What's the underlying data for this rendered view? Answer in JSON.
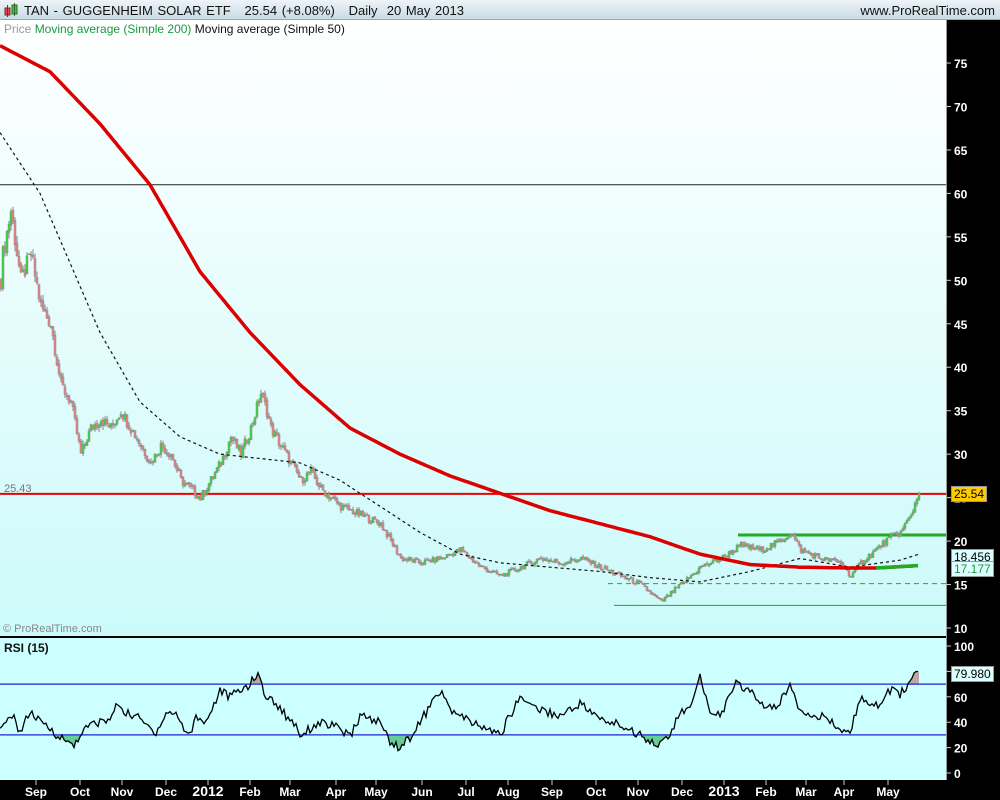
{
  "header": {
    "title": "TAN - GUGGENHEIM SOLAR ETF   25.54 (+8.08%)   Daily  20 May 2013",
    "site": "www.ProRealTime.com"
  },
  "legend": {
    "price": "Price",
    "sma200": "Moving average (Simple 200)",
    "sma50": "Moving average (Simple 50)"
  },
  "watermark": "© ProRealTime.com",
  "colors": {
    "up": "#33dd33",
    "down": "#f08080",
    "sma200": "#dd0000",
    "sma50": "#111111",
    "rsi": "#000000",
    "level": "#2222cc",
    "green_line": "#22aa22"
  },
  "chart_data": [
    {
      "type": "candlestick",
      "title": "TAN - GUGGENHEIM SOLAR ETF",
      "last": 25.54,
      "change": "+8.08%",
      "ylim": [
        10,
        77
      ],
      "yticks": [
        10,
        15,
        20,
        25,
        30,
        35,
        40,
        45,
        50,
        55,
        60,
        65,
        70,
        75
      ],
      "x_unit": "trading-day index",
      "days": 460,
      "xticks": [
        {
          "d": 18,
          "label": "Sep"
        },
        {
          "d": 40,
          "label": "Oct"
        },
        {
          "d": 61,
          "label": "Nov"
        },
        {
          "d": 83,
          "label": "Dec"
        },
        {
          "d": 104,
          "label": "2012"
        },
        {
          "d": 125,
          "label": "Feb"
        },
        {
          "d": 145,
          "label": "Mar"
        },
        {
          "d": 168,
          "label": "Apr"
        },
        {
          "d": 188,
          "label": "May"
        },
        {
          "d": 211,
          "label": "Jun"
        },
        {
          "d": 233,
          "label": "Jul"
        },
        {
          "d": 254,
          "label": "Aug"
        },
        {
          "d": 276,
          "label": "Sep"
        },
        {
          "d": 298,
          "label": "Oct"
        },
        {
          "d": 319,
          "label": "Nov"
        },
        {
          "d": 341,
          "label": "Dec"
        },
        {
          "d": 362,
          "label": "2013"
        },
        {
          "d": 383,
          "label": "Feb"
        },
        {
          "d": 403,
          "label": "Mar"
        },
        {
          "d": 422,
          "label": "Apr"
        },
        {
          "d": 444,
          "label": "May"
        }
      ],
      "close_keypoints": [
        [
          0,
          50
        ],
        [
          1,
          53
        ],
        [
          5,
          58
        ],
        [
          10,
          50
        ],
        [
          15,
          53
        ],
        [
          20,
          47
        ],
        [
          25,
          45
        ],
        [
          30,
          38
        ],
        [
          35,
          36
        ],
        [
          40,
          30
        ],
        [
          45,
          33
        ],
        [
          50,
          34
        ],
        [
          55,
          33
        ],
        [
          60,
          35
        ],
        [
          65,
          33
        ],
        [
          70,
          31
        ],
        [
          75,
          29
        ],
        [
          80,
          31
        ],
        [
          85,
          30
        ],
        [
          90,
          27
        ],
        [
          95,
          26
        ],
        [
          100,
          25
        ],
        [
          105,
          27
        ],
        [
          110,
          29
        ],
        [
          115,
          32
        ],
        [
          120,
          30
        ],
        [
          125,
          33
        ],
        [
          130,
          37
        ],
        [
          133,
          35
        ],
        [
          135,
          33
        ],
        [
          140,
          31
        ],
        [
          145,
          29
        ],
        [
          150,
          27
        ],
        [
          155,
          28
        ],
        [
          160,
          26
        ],
        [
          170,
          24
        ],
        [
          180,
          23
        ],
        [
          190,
          22
        ],
        [
          200,
          18
        ],
        [
          210,
          17.5
        ],
        [
          220,
          18
        ],
        [
          230,
          19
        ],
        [
          240,
          17
        ],
        [
          250,
          16
        ],
        [
          260,
          17
        ],
        [
          270,
          18
        ],
        [
          280,
          17.5
        ],
        [
          290,
          18
        ],
        [
          300,
          17
        ],
        [
          310,
          16
        ],
        [
          320,
          15
        ],
        [
          330,
          13
        ],
        [
          340,
          15
        ],
        [
          350,
          17
        ],
        [
          360,
          18
        ],
        [
          370,
          19.5
        ],
        [
          380,
          19
        ],
        [
          390,
          20
        ],
        [
          395,
          21
        ],
        [
          400,
          19
        ],
        [
          410,
          18
        ],
        [
          420,
          17.5
        ],
        [
          425,
          16
        ],
        [
          430,
          17.5
        ],
        [
          440,
          19.5
        ],
        [
          445,
          20.5
        ],
        [
          450,
          21
        ],
        [
          455,
          23
        ],
        [
          459,
          25.54
        ]
      ],
      "series": [
        {
          "name": "Moving average (Simple 200)",
          "last": 17.177,
          "keypoints": [
            [
              0,
              77
            ],
            [
              25,
              74
            ],
            [
              50,
              68
            ],
            [
              75,
              61
            ],
            [
              100,
              51
            ],
            [
              125,
              44
            ],
            [
              150,
              38
            ],
            [
              175,
              33
            ],
            [
              200,
              30
            ],
            [
              225,
              27.5
            ],
            [
              250,
              25.5
            ],
            [
              275,
              23.5
            ],
            [
              300,
              22
            ],
            [
              325,
              20.5
            ],
            [
              350,
              18.5
            ],
            [
              375,
              17.3
            ],
            [
              400,
              17
            ],
            [
              425,
              16.9
            ],
            [
              438,
              16.9
            ],
            [
              459,
              17.177
            ]
          ]
        },
        {
          "name": "Moving average (Simple 50)",
          "last": 18.456,
          "keypoints": [
            [
              0,
              67
            ],
            [
              20,
              60
            ],
            [
              35,
              52
            ],
            [
              50,
              44
            ],
            [
              70,
              36
            ],
            [
              90,
              32
            ],
            [
              110,
              30
            ],
            [
              130,
              29.5
            ],
            [
              150,
              29
            ],
            [
              170,
              27
            ],
            [
              190,
              24
            ],
            [
              210,
              21
            ],
            [
              230,
              18.5
            ],
            [
              250,
              17.5
            ],
            [
              275,
              17
            ],
            [
              300,
              16.5
            ],
            [
              325,
              15.8
            ],
            [
              350,
              15.3
            ],
            [
              375,
              16.5
            ],
            [
              400,
              18
            ],
            [
              425,
              17
            ],
            [
              450,
              17.8
            ],
            [
              459,
              18.456
            ]
          ]
        }
      ],
      "hlines": [
        {
          "value": 61,
          "color": "#222222",
          "label": ""
        },
        {
          "value": 25.43,
          "color": "#ee0000",
          "label": "25.43"
        },
        {
          "value": 20.7,
          "from": 369,
          "color": "#22aa22",
          "style": "thick"
        },
        {
          "value": 15.1,
          "from": 304,
          "color": "#22aa22",
          "style": "dashed"
        },
        {
          "value": 12.6,
          "from": 307,
          "color": "#22aa22",
          "style": "thin"
        }
      ]
    },
    {
      "type": "line",
      "title": "RSI (15)",
      "ylim": [
        0,
        100
      ],
      "yticks": [
        0,
        20,
        40,
        60,
        80,
        100
      ],
      "levels": [
        30,
        70
      ],
      "last": 79.98,
      "keypoints": [
        [
          0,
          33
        ],
        [
          3,
          38
        ],
        [
          5,
          47
        ],
        [
          8,
          40
        ],
        [
          10,
          32
        ],
        [
          13,
          42
        ],
        [
          15,
          48
        ],
        [
          20,
          40
        ],
        [
          25,
          35
        ],
        [
          30,
          28
        ],
        [
          33,
          25
        ],
        [
          37,
          22
        ],
        [
          40,
          30
        ],
        [
          45,
          38
        ],
        [
          50,
          40
        ],
        [
          55,
          42
        ],
        [
          59,
          55
        ],
        [
          63,
          47
        ],
        [
          68,
          45
        ],
        [
          73,
          38
        ],
        [
          78,
          32
        ],
        [
          83,
          47
        ],
        [
          88,
          47
        ],
        [
          93,
          32
        ],
        [
          95,
          30
        ],
        [
          98,
          45
        ],
        [
          103,
          40
        ],
        [
          105,
          47
        ],
        [
          110,
          65
        ],
        [
          115,
          60
        ],
        [
          120,
          65
        ],
        [
          125,
          70
        ],
        [
          129,
          78
        ],
        [
          133,
          60
        ],
        [
          138,
          55
        ],
        [
          143,
          45
        ],
        [
          148,
          38
        ],
        [
          150,
          30
        ],
        [
          160,
          40
        ],
        [
          170,
          35
        ],
        [
          175,
          28
        ],
        [
          180,
          45
        ],
        [
          190,
          40
        ],
        [
          195,
          25
        ],
        [
          200,
          20
        ],
        [
          205,
          28
        ],
        [
          210,
          40
        ],
        [
          220,
          65
        ],
        [
          225,
          50
        ],
        [
          235,
          40
        ],
        [
          250,
          30
        ],
        [
          260,
          60
        ],
        [
          270,
          50
        ],
        [
          280,
          45
        ],
        [
          290,
          55
        ],
        [
          300,
          42
        ],
        [
          310,
          38
        ],
        [
          320,
          30
        ],
        [
          330,
          22
        ],
        [
          335,
          30
        ],
        [
          340,
          48
        ],
        [
          345,
          50
        ],
        [
          350,
          75
        ],
        [
          355,
          50
        ],
        [
          360,
          45
        ],
        [
          368,
          70
        ],
        [
          375,
          65
        ],
        [
          380,
          55
        ],
        [
          388,
          50
        ],
        [
          395,
          70
        ],
        [
          400,
          50
        ],
        [
          410,
          45
        ],
        [
          415,
          40
        ],
        [
          425,
          30
        ],
        [
          430,
          60
        ],
        [
          435,
          50
        ],
        [
          440,
          55
        ],
        [
          445,
          65
        ],
        [
          450,
          62
        ],
        [
          455,
          72
        ],
        [
          459,
          79.98
        ]
      ]
    }
  ]
}
